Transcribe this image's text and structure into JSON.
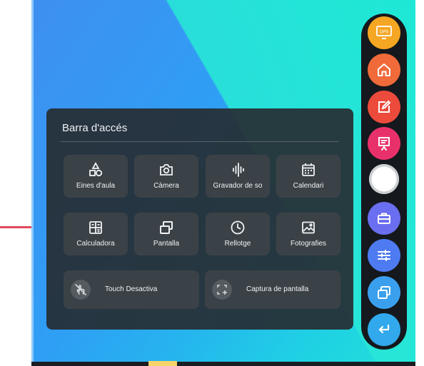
{
  "panel": {
    "title": "Barra d'accés",
    "tiles": [
      {
        "label": "Eines d'aula",
        "icon": "shapes-icon"
      },
      {
        "label": "Càmera",
        "icon": "camera-icon"
      },
      {
        "label": "Gravador de so",
        "icon": "audio-waveform-icon"
      },
      {
        "label": "Calendari",
        "icon": "calendar-icon"
      },
      {
        "label": "Calculadora",
        "icon": "calculator-icon"
      },
      {
        "label": "Pantalla",
        "icon": "windows-icon"
      },
      {
        "label": "Rellotge",
        "icon": "clock-icon"
      },
      {
        "label": "Fotografies",
        "icon": "image-icon"
      }
    ],
    "wide_buttons": [
      {
        "label": "Touch Desactiva",
        "icon": "touch-disabled-icon"
      },
      {
        "label": "Captura de pantalla",
        "icon": "screenshot-icon"
      }
    ]
  },
  "dock": {
    "ops_label": "OPS",
    "buttons": [
      {
        "name": "ops-button",
        "icon": "ops-monitor-icon",
        "color": "#f5a623"
      },
      {
        "name": "home-button",
        "icon": "home-icon",
        "color": "#f06a3a"
      },
      {
        "name": "annotate-button",
        "icon": "edit-note-icon",
        "color": "#ec4b3c"
      },
      {
        "name": "whiteboard-button",
        "icon": "presentation-icon",
        "color": "#e8316a"
      },
      {
        "name": "center-button",
        "icon": "circle-icon",
        "color": "#ffffff"
      },
      {
        "name": "toolbox-button",
        "icon": "toolbox-icon",
        "color": "#6a6ef0"
      },
      {
        "name": "settings-button",
        "icon": "sliders-icon",
        "color": "#4e7bf2"
      },
      {
        "name": "windows-button",
        "icon": "windows-icon",
        "color": "#3aa0ee"
      },
      {
        "name": "back-button",
        "icon": "return-icon",
        "color": "#31a9ec"
      }
    ]
  }
}
